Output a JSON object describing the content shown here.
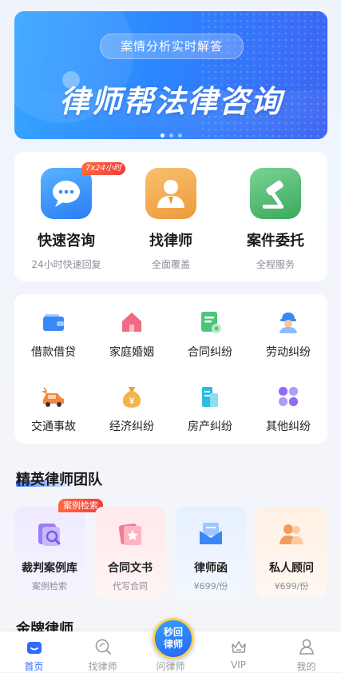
{
  "banner": {
    "pill": "案情分析实时解答",
    "title": "律师帮法律咨询"
  },
  "services": [
    {
      "name": "快速咨询",
      "sub": "24小时快速回复",
      "badge": "7x24小时",
      "icon": "chat-bubble-icon",
      "color": "#2f8bff"
    },
    {
      "name": "找律师",
      "sub": "全面覆盖",
      "icon": "lawyer-avatar-icon",
      "color": "#f2a64a"
    },
    {
      "name": "案件委托",
      "sub": "全程服务",
      "icon": "gavel-icon",
      "color": "#45b66a"
    }
  ],
  "categories": [
    {
      "label": "借款借贷",
      "icon": "wallet-icon"
    },
    {
      "label": "家庭婚姻",
      "icon": "house-icon"
    },
    {
      "label": "合同纠纷",
      "icon": "contract-icon"
    },
    {
      "label": "劳动纠纷",
      "icon": "worker-icon"
    },
    {
      "label": "交通事故",
      "icon": "car-crash-icon"
    },
    {
      "label": "经济纠纷",
      "icon": "money-bag-icon"
    },
    {
      "label": "房产纠纷",
      "icon": "building-icon"
    },
    {
      "label": "其他纠纷",
      "icon": "grid-more-icon"
    }
  ],
  "elite": {
    "title": "精英律师团队",
    "badge": "案例检索",
    "items": [
      {
        "name": "裁判案例库",
        "sub": "案例检索",
        "icon": "case-library-icon"
      },
      {
        "name": "合同文书",
        "sub": "代写合同",
        "icon": "contract-doc-icon"
      },
      {
        "name": "律师函",
        "sub": "¥699/份",
        "icon": "lawyer-letter-icon"
      },
      {
        "name": "私人顾问",
        "sub": "¥699/份",
        "icon": "advisor-icon"
      }
    ]
  },
  "next_section": "金牌律师",
  "tabbar": {
    "center": {
      "line1": "秒回",
      "line2": "律师"
    },
    "tabs": [
      {
        "label": "首页",
        "icon": "home-icon",
        "active": true
      },
      {
        "label": "找律师",
        "icon": "search-lawyer-icon"
      },
      {
        "label": "问律师",
        "icon": "ask-lawyer-icon"
      },
      {
        "label": "VIP",
        "icon": "crown-icon"
      },
      {
        "label": "我的",
        "icon": "profile-icon"
      }
    ]
  },
  "colors": {
    "accent": "#2f6bff",
    "badge": "#f23c3c"
  }
}
